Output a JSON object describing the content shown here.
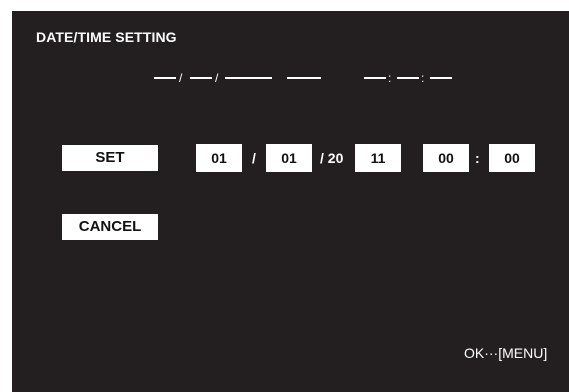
{
  "dialog": {
    "title": "DATE/TIME SETTING",
    "placeholder": {
      "date_sep_1": "/",
      "date_sep_2": "/",
      "time_sep_1": ":",
      "time_sep_2": ":"
    },
    "buttons": {
      "set": "SET",
      "cancel": "CANCEL"
    },
    "fields": {
      "month": "01",
      "sep_month_day": "/",
      "day": "01",
      "year_prefix": "/ 20",
      "year": "11",
      "hour": "00",
      "time_sep": ":",
      "minute": "00"
    },
    "footer_hint": "OK···[MENU]"
  }
}
